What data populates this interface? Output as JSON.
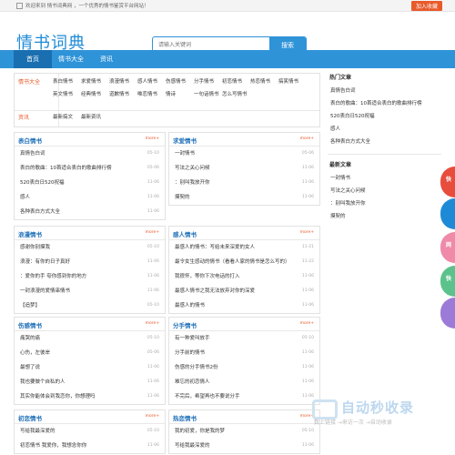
{
  "topbar": {
    "welcome": "欢迎来到 情书词典网 ，一个优秀的情书鉴赏平台网站！",
    "favorite": "加入收藏"
  },
  "header": {
    "logo": "情书词典",
    "search_placeholder": "请输入关键词",
    "search_button": "搜索"
  },
  "nav": {
    "items": [
      "首页",
      "情书大全",
      "资讯"
    ]
  },
  "categories": {
    "title1": "情书大全",
    "tags1": [
      "表白情书",
      "求爱情书",
      "浪漫情书",
      "感人情书",
      "伤感情书",
      "分手情书",
      "初恋情书",
      "热恋情书",
      "搞笑情书",
      "英文情书",
      "经典情书",
      "道歉情书",
      "唯恋情书",
      "情诗",
      "一句话情书",
      "怎么写情书"
    ],
    "title2": "资讯",
    "tags2": [
      "最新搞文",
      "最新资讯"
    ]
  },
  "boxes": [
    {
      "title": "表白情书",
      "more": "more+",
      "items": [
        {
          "t": "真情告白词",
          "d": "05-10"
        },
        {
          "t": "表白的歌曲：10首适合表白的歌曲排行榜",
          "d": "05-06"
        },
        {
          "t": "520表白日520祝福",
          "d": "11-06"
        },
        {
          "t": "感人",
          "d": "11-06"
        },
        {
          "t": "各种表白方式大全",
          "d": "11-06"
        }
      ]
    },
    {
      "title": "求爱情书",
      "more": "more+",
      "items": [
        {
          "t": "一封情书",
          "d": "05-06"
        },
        {
          "t": "写法之关心问候",
          "d": "11-06"
        },
        {
          "t": "：别叫我放开你",
          "d": "11-06"
        },
        {
          "t": "摸契的",
          "d": "11-06"
        }
      ]
    },
    {
      "title": "浪漫情书",
      "more": "more+",
      "items": [
        {
          "t": "感谢你别摸我",
          "d": "05-10"
        },
        {
          "t": "浪漫：有你的日子真好",
          "d": "11-06"
        },
        {
          "t": "：爱你的手 夸你感到你的地方",
          "d": "11-06"
        },
        {
          "t": "一封浪漫的爱情串情书",
          "d": "11-06"
        },
        {
          "t": "【追梦】",
          "d": "05-10"
        }
      ]
    },
    {
      "title": "感人情书",
      "more": "more+",
      "items": [
        {
          "t": "最感人的情书：写给未来深爱的女人",
          "d": "11-21"
        },
        {
          "t": "最令女生感动的情书（看看人家的情书是怎么写的）",
          "d": "11-22"
        },
        {
          "t": "我很怀，等你下次电话的打入",
          "d": "11-06"
        },
        {
          "t": "最感人情书之我无法放弃对你的深爱",
          "d": "11-06"
        },
        {
          "t": "最感人的情书",
          "d": "11-06"
        }
      ]
    },
    {
      "title": "伤感情书",
      "more": "more+",
      "items": [
        {
          "t": "痛哭的痛",
          "d": "05-10"
        },
        {
          "t": "心伤，左彼岸",
          "d": "05-06"
        },
        {
          "t": "最想了说",
          "d": "11-06"
        },
        {
          "t": "我也要做个自私的人",
          "d": "11-06"
        },
        {
          "t": "其实你能体会到我恋你，你想理吗",
          "d": "11-06"
        }
      ]
    },
    {
      "title": "分手情书",
      "more": "more+",
      "items": [
        {
          "t": "有一种爱叫放手",
          "d": "05-10"
        },
        {
          "t": "分手前的情书",
          "d": "11-06"
        },
        {
          "t": "伤感的分手情书2份",
          "d": "11-06"
        },
        {
          "t": "难忘的初恋情人",
          "d": "11-06"
        },
        {
          "t": "不完后，希望再也不要说分手",
          "d": "11-06"
        }
      ]
    },
    {
      "title": "初恋情书",
      "more": "more+",
      "items": [
        {
          "t": "写给我最深爱的",
          "d": "05-10"
        },
        {
          "t": "初恋情书 我爱你，我想念你你",
          "d": "11-06"
        }
      ]
    },
    {
      "title": "热恋情书",
      "more": "more+",
      "items": [
        {
          "t": "我的初爱，你是我的梦",
          "d": "05-10"
        },
        {
          "t": "写给我最深爱的",
          "d": "11-06"
        }
      ]
    }
  ],
  "sidebar": {
    "hot_title": "热门文章",
    "hot": [
      "真情告白词",
      "表白的歌曲：10首适合表白的歌曲排行榜",
      "520表白日520祝福",
      "感人",
      "各种表白方式大全"
    ],
    "new_title": "最新文章",
    "new": [
      "一封情书",
      "写法之关心问候",
      "：别叫我放开你",
      "摸契的"
    ]
  },
  "floats": [
    {
      "label": "快",
      "color": "#e84c3d"
    },
    {
      "label": "",
      "color": "#1e8ad6"
    },
    {
      "label": "网",
      "color": "#ef8aa8"
    },
    {
      "label": "快",
      "color": "#5cc28b"
    },
    {
      "label": "",
      "color": "#9c7ad8"
    }
  ],
  "watermark": {
    "big": "自动秒收录",
    "small": "数上链接 →来访一次 →自动收录"
  }
}
